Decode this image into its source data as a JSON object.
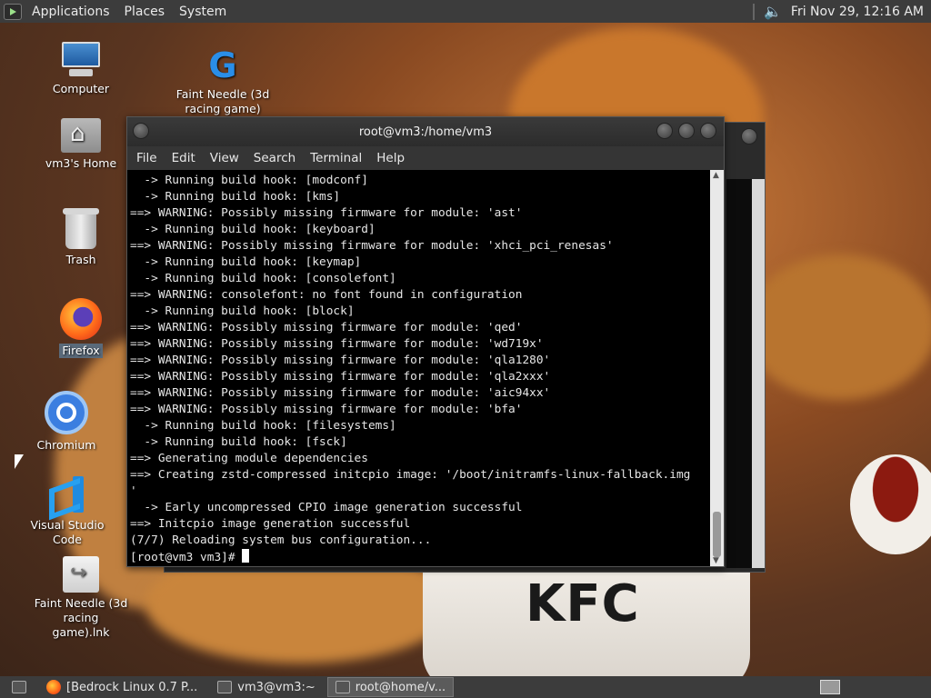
{
  "top_panel": {
    "menus": [
      "Applications",
      "Places",
      "System"
    ],
    "clock": "Fri Nov 29, 12:16 AM"
  },
  "desktop_icons": {
    "computer": "Computer",
    "home": "vm3's Home",
    "trash": "Trash",
    "firefox": "Firefox",
    "chromium": "Chromium",
    "vscode": "Visual Studio Code",
    "faint_needle": "Faint Needle (3d racing game)",
    "faint_needle_lnk": "Faint Needle (3d racing game).lnk"
  },
  "wallpaper": {
    "bucket_text": "KFC"
  },
  "terminal": {
    "title": "root@vm3:/home/vm3",
    "menu": [
      "File",
      "Edit",
      "View",
      "Search",
      "Terminal",
      "Help"
    ],
    "lines": [
      "  -> Running build hook: [modconf]",
      "  -> Running build hook: [kms]",
      "==> WARNING: Possibly missing firmware for module: 'ast'",
      "  -> Running build hook: [keyboard]",
      "==> WARNING: Possibly missing firmware for module: 'xhci_pci_renesas'",
      "  -> Running build hook: [keymap]",
      "  -> Running build hook: [consolefont]",
      "==> WARNING: consolefont: no font found in configuration",
      "  -> Running build hook: [block]",
      "==> WARNING: Possibly missing firmware for module: 'qed'",
      "==> WARNING: Possibly missing firmware for module: 'wd719x'",
      "==> WARNING: Possibly missing firmware for module: 'qla1280'",
      "==> WARNING: Possibly missing firmware for module: 'qla2xxx'",
      "==> WARNING: Possibly missing firmware for module: 'aic94xx'",
      "==> WARNING: Possibly missing firmware for module: 'bfa'",
      "  -> Running build hook: [filesystems]",
      "  -> Running build hook: [fsck]",
      "==> Generating module dependencies",
      "==> Creating zstd-compressed initcpio image: '/boot/initramfs-linux-fallback.img",
      "'",
      "  -> Early uncompressed CPIO image generation successful",
      "==> Initcpio image generation successful",
      "(7/7) Reloading system bus configuration...",
      "[root@vm3 vm3]# "
    ]
  },
  "taskbar": {
    "items": [
      "[Bedrock Linux 0.7 P...",
      "vm3@vm3:~",
      "root@home/v..."
    ]
  }
}
